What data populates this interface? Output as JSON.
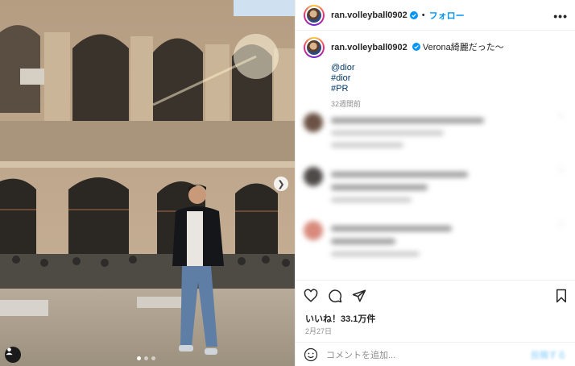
{
  "post": {
    "username": "ran.volleyball0902",
    "separator": "•",
    "follow_label": "フォロー",
    "more_label": "•••"
  },
  "caption": {
    "username": "ran.volleyball0902",
    "text": "Verona綺麗だった～",
    "mention": "@dior",
    "hashtags": [
      "#dior",
      "#PR"
    ],
    "time_ago": "32週間前"
  },
  "comments_blurred": true,
  "actions": {
    "like_icon": "heart-icon",
    "comment_icon": "comment-icon",
    "share_icon": "send-icon",
    "save_icon": "bookmark-icon"
  },
  "likes": "いいね！33.1万件",
  "date": "2月27日",
  "composer": {
    "placeholder": "コメントを追加...",
    "post_label": "投稿する"
  },
  "colors": {
    "accent": "#0095f6",
    "verified": "#0095f6",
    "text": "#262626",
    "muted": "#8e8e8e",
    "link": "#00376b"
  }
}
